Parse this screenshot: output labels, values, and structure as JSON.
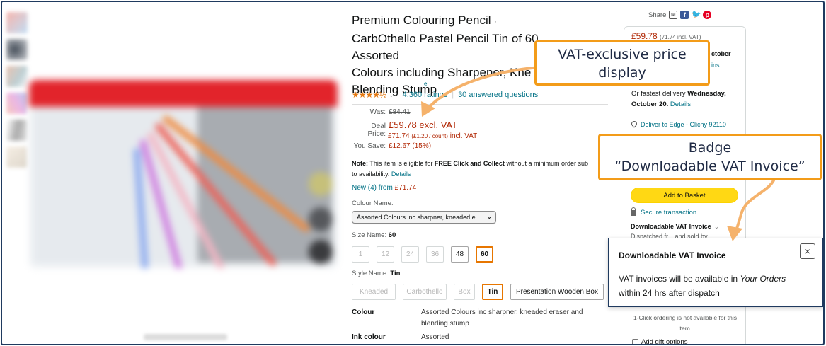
{
  "gallery": {
    "thumbnails": [
      "thumb-1",
      "thumb-2",
      "thumb-3",
      "thumb-4",
      "thumb-5",
      "thumb-6"
    ]
  },
  "product": {
    "title": "Premium Colouring Pencil CarbOthello Pastel Pencil Tin of 60 Assorted Colours including Sharpener, Kneaded Eraser and Blending Stump",
    "title_line1": "Premium Colouring Pencil",
    "title_line2": "CarbOthello Pastel Pencil Tin of 60 Assorted",
    "title_line3": "Colours including Sharpener, Kne",
    "title_line4": "Blending Stump",
    "visit_store": "e",
    "rating_stars": "★★★★½",
    "ratings_count": "4,360 ratings",
    "answered": "30 answered questions"
  },
  "price": {
    "was_label": "Was:",
    "was_value": "£84.41",
    "deal_label": "Deal Price:",
    "deal_value": "£59.78 excl. VAT",
    "incl_prefix": "£71.74",
    "incl_count": "(£1.20 / count)",
    "incl_suffix": "incl. VAT",
    "save_label": "You Save:",
    "save_value": "£12.67 (15%)"
  },
  "note": {
    "label": "Note:",
    "text1": "This item is eligible for",
    "bold": "FREE Click and Collect",
    "text2": "without a minimum order sub",
    "text3": "to availability.",
    "details": "Details"
  },
  "new_from": {
    "label": "New (4) from",
    "price": "£71.74"
  },
  "colour": {
    "label": "Colour Name:",
    "selected": "Assorted Colours inc sharpner, kneaded e..."
  },
  "size": {
    "label": "Size Name:",
    "selected": "60",
    "options": [
      "1",
      "12",
      "24",
      "36",
      "48",
      "60"
    ]
  },
  "style": {
    "label": "Style Name:",
    "selected": "Tin",
    "options": [
      "Kneaded",
      "Carbothello",
      "Box",
      "Tin",
      "Presentation Wooden Box"
    ]
  },
  "specs": {
    "colour_key": "Colour",
    "colour_val": "Assorted Colours inc sharpner, kneaded eraser and blending stump",
    "ink_key": "Ink colour",
    "ink_val": "Assorted"
  },
  "buybox": {
    "share_label": "Share",
    "price": "£59.78",
    "price_incl": "(71.74 incl. VAT)",
    "delivery_date_frag": "ctober",
    "delivery_link_frag": "ins.",
    "fastest_prefix": "Or fastest delivery",
    "fastest_date": "Wednesday, October 20.",
    "fastest_details": "Details",
    "deliver_to": "Deliver to Edge - Clichy 92110",
    "add_basket": "Add to Basket",
    "secure": "Secure transaction",
    "dl_badge": "Downloadable VAT Invoice",
    "dl_chevron": "⌄",
    "dispatched": "Dispatched fr... and sold by",
    "one_click": "1-Click ordering is not available for this item.",
    "gift": "Add gift options"
  },
  "popover": {
    "heading": "Downloadable VAT Invoice",
    "body_prefix": "VAT invoices will be available in",
    "body_em": "Your Orders",
    "body_suffix": "within 24 hrs after dispatch",
    "close": "×"
  },
  "callouts": {
    "price_line1": "VAT-exclusive price",
    "price_line2": "display",
    "badge_line1": "Badge",
    "badge_line2": "“Downloadable VAT Invoice”"
  },
  "colors": {
    "accent": "#f39c19",
    "frame": "#1f3a5f",
    "price_red": "#b12704",
    "link_teal": "#007185",
    "basket_yellow": "#ffd814"
  }
}
